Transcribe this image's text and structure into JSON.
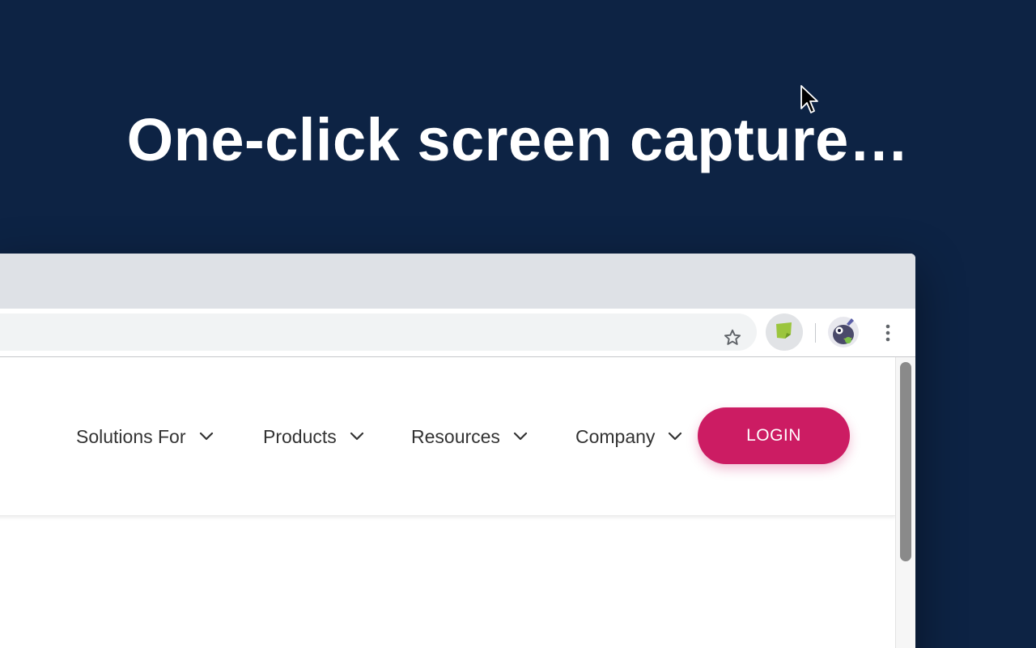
{
  "headline": "One-click screen capture…",
  "toolbar": {
    "bookmark_icon": "star-outline-icon",
    "extension_icon": "green-note-extension-icon",
    "profile_icon": "profile-avatar-icon",
    "menu_icon": "vertical-dots-icon"
  },
  "site_nav": {
    "items": [
      {
        "label": "Solutions For",
        "icon": "chevron-down-icon"
      },
      {
        "label": "Products",
        "icon": "chevron-down-icon"
      },
      {
        "label": "Resources",
        "icon": "chevron-down-icon"
      },
      {
        "label": "Company",
        "icon": "chevron-down-icon"
      }
    ],
    "login_label": "LOGIN"
  },
  "colors": {
    "background": "#0d2344",
    "login_button": "#cc1c63",
    "extension_green": "#9bc53d"
  }
}
